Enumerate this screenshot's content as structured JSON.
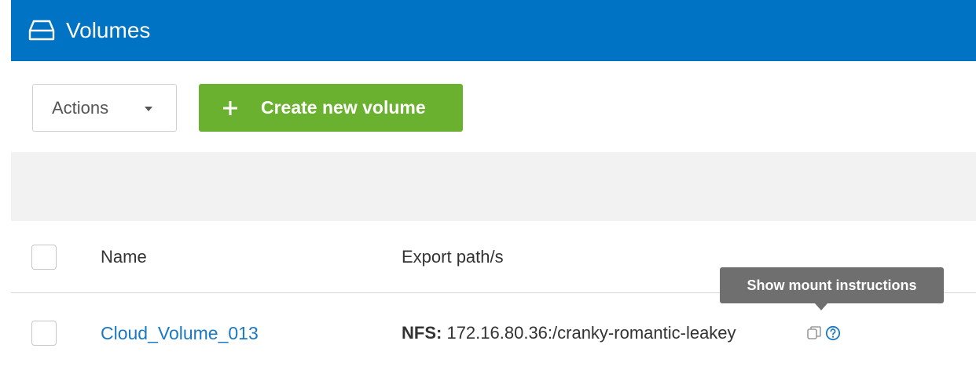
{
  "header": {
    "icon": "drive-icon",
    "title": "Volumes"
  },
  "toolbar": {
    "actions_label": "Actions",
    "create_label": "Create new volume",
    "create_icon": "plus-icon"
  },
  "table": {
    "columns": [
      "Name",
      "Export path/s"
    ],
    "rows": [
      {
        "name": "Cloud_Volume_013",
        "export_protocol": "NFS:",
        "export_path": "172.16.80.36:/cranky-romantic-leakey"
      }
    ]
  },
  "tooltip": {
    "text": "Show mount instructions"
  },
  "colors": {
    "header_bg": "#0073c4",
    "create_button_bg": "#6ab12f",
    "link": "#1a79c4",
    "tooltip_bg": "#6f6f6f"
  }
}
